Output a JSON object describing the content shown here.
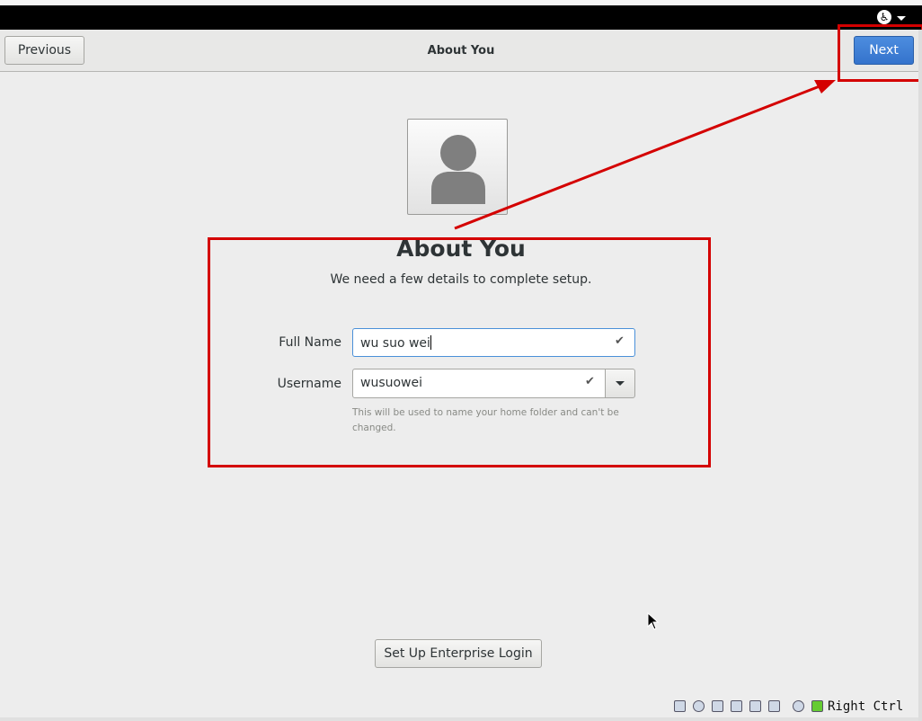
{
  "topbar": {
    "accessibility_icon": "accessibility-icon"
  },
  "header": {
    "previous_label": "Previous",
    "title": "About You",
    "next_label": "Next"
  },
  "avatar": {
    "icon": "user-avatar-icon"
  },
  "page": {
    "title": "About You",
    "subtitle": "We need a few details to complete setup."
  },
  "form": {
    "full_name_label": "Full Name",
    "full_name_value": "wu suo wei",
    "username_label": "Username",
    "username_value": "wusuowei",
    "hint": "This will be used to name your home folder and can't be changed.",
    "check_glyph": "✔"
  },
  "enterprise_label": "Set Up Enterprise Login",
  "statusbar": {
    "host_key": "Right Ctrl"
  },
  "colors": {
    "accent": "#3d7fd6",
    "annotation": "#d40000"
  }
}
